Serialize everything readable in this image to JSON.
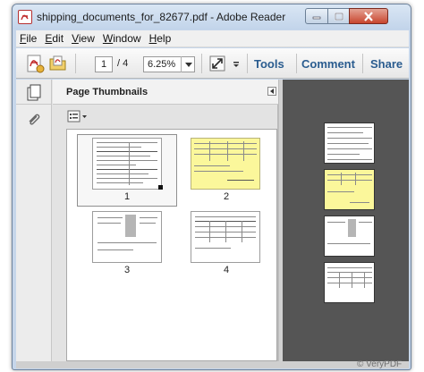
{
  "window": {
    "title": "shipping_documents_for_82677.pdf - Adobe Reader",
    "controls": [
      "minimize-icon",
      "maximize-icon",
      "close-icon"
    ]
  },
  "menu": {
    "items": [
      {
        "key": "F",
        "rest": "ile"
      },
      {
        "key": "E",
        "rest": "dit"
      },
      {
        "key": "V",
        "rest": "iew"
      },
      {
        "key": "W",
        "rest": "indow"
      },
      {
        "key": "H",
        "rest": "elp"
      }
    ]
  },
  "toolbar": {
    "page_current": "1",
    "page_total": "/ 4",
    "zoom": "6.25%",
    "tools_label": "Tools",
    "comment_label": "Comment",
    "share_label": "Share",
    "icons": [
      "create-pdf-icon",
      "open-file-icon",
      "fit-page-icon",
      "more-options-icon"
    ]
  },
  "panel": {
    "title": "Page Thumbnails",
    "thumbnails": [
      {
        "label": "1",
        "selected": true,
        "color": "white"
      },
      {
        "label": "2",
        "selected": false,
        "color": "yellow"
      },
      {
        "label": "3",
        "selected": false,
        "color": "white"
      },
      {
        "label": "4",
        "selected": false,
        "color": "white"
      }
    ]
  },
  "document_view": {
    "pages": [
      "white",
      "yellow",
      "white",
      "white"
    ]
  },
  "watermark": "© VeryPDF",
  "colors": {
    "yellow_page": "#fbf79b",
    "doc_background": "#555555",
    "accent": "#2a5c8f"
  }
}
